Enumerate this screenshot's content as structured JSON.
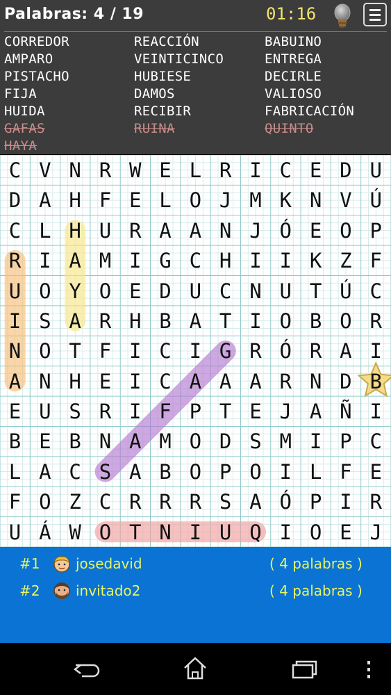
{
  "header": {
    "title": "Palabras: 4 / 19",
    "timer": "01:16",
    "hint_icon": "lightbulb-icon",
    "menu_icon": "hamburger-menu-icon"
  },
  "words": [
    {
      "text": "CORREDOR",
      "found": false
    },
    {
      "text": "REACCIÓN",
      "found": false
    },
    {
      "text": "BABUINO",
      "found": false
    },
    {
      "text": "AMPARO",
      "found": false
    },
    {
      "text": "VEINTICINCO",
      "found": false
    },
    {
      "text": "ENTREGA",
      "found": false
    },
    {
      "text": "PISTACHO",
      "found": false
    },
    {
      "text": "HUBIESE",
      "found": false
    },
    {
      "text": "DECIRLE",
      "found": false
    },
    {
      "text": "FIJA",
      "found": false
    },
    {
      "text": "DAMOS",
      "found": false
    },
    {
      "text": "VALIOSO",
      "found": false
    },
    {
      "text": "HUIDA",
      "found": false
    },
    {
      "text": "RECIBIR",
      "found": false
    },
    {
      "text": "FABRICACIÓN",
      "found": false
    },
    {
      "text": "GAFAS",
      "found": true
    },
    {
      "text": "RUINA",
      "found": true
    },
    {
      "text": "QUINTO",
      "found": true
    },
    {
      "text": "HAYA",
      "found": true
    }
  ],
  "grid": [
    [
      "C",
      "V",
      "N",
      "R",
      "W",
      "E",
      "L",
      "R",
      "I",
      "C",
      "E",
      "D",
      "U"
    ],
    [
      "D",
      "A",
      "H",
      "F",
      "E",
      "L",
      "O",
      "J",
      "M",
      "K",
      "N",
      "V",
      "Ú"
    ],
    [
      "C",
      "L",
      "H",
      "U",
      "R",
      "A",
      "A",
      "N",
      "J",
      "Ó",
      "E",
      "O",
      "P"
    ],
    [
      "R",
      "I",
      "A",
      "M",
      "I",
      "G",
      "C",
      "H",
      "I",
      "I",
      "K",
      "Z",
      "F"
    ],
    [
      "U",
      "O",
      "Y",
      "O",
      "E",
      "D",
      "U",
      "C",
      "N",
      "U",
      "T",
      "Ú",
      "C"
    ],
    [
      "I",
      "S",
      "A",
      "R",
      "H",
      "B",
      "A",
      "T",
      "I",
      "O",
      "B",
      "O",
      "R"
    ],
    [
      "N",
      "O",
      "T",
      "F",
      "I",
      "C",
      "I",
      "G",
      "R",
      "Ó",
      "R",
      "A",
      "I"
    ],
    [
      "A",
      "N",
      "H",
      "E",
      "I",
      "C",
      "A",
      "A",
      "A",
      "R",
      "N",
      "D",
      "B"
    ],
    [
      "E",
      "U",
      "S",
      "R",
      "I",
      "F",
      "P",
      "T",
      "E",
      "J",
      "A",
      "Ñ",
      "I"
    ],
    [
      "B",
      "E",
      "B",
      "N",
      "A",
      "M",
      "O",
      "D",
      "S",
      "M",
      "I",
      "P",
      "C"
    ],
    [
      "L",
      "A",
      "C",
      "S",
      "A",
      "B",
      "O",
      "P",
      "O",
      "I",
      "L",
      "F",
      "E"
    ],
    [
      "F",
      "O",
      "Z",
      "C",
      "R",
      "R",
      "R",
      "S",
      "A",
      "Ó",
      "P",
      "I",
      "R"
    ],
    [
      "U",
      "Á",
      "W",
      "O",
      "T",
      "N",
      "I",
      "U",
      "Q",
      "I",
      "O",
      "E",
      "J"
    ]
  ],
  "highlights": [
    {
      "word": "RUINA",
      "from": [
        3,
        0
      ],
      "to": [
        7,
        0
      ],
      "color": "#f6c07a"
    },
    {
      "word": "HAYA",
      "from": [
        2,
        2
      ],
      "to": [
        5,
        2
      ],
      "color": "#f8e88a"
    },
    {
      "word": "GAFAS",
      "from": [
        6,
        7
      ],
      "to": [
        10,
        3
      ],
      "color": "#b57ad0"
    },
    {
      "word": "QUINTO",
      "from": [
        12,
        3
      ],
      "to": [
        12,
        8
      ],
      "color": "#f2a0a0"
    }
  ],
  "star_cell": [
    7,
    12
  ],
  "players": [
    {
      "rank": "#1",
      "name": "josedavid",
      "score": "( 4 palabras )",
      "avatar": "blond-avatar-icon"
    },
    {
      "rank": "#2",
      "name": "invitado2",
      "score": "( 4 palabras )",
      "avatar": "bearded-avatar-icon"
    }
  ],
  "colors": {
    "header_bg": "#3c3c3c",
    "found_word": "#c98a8a",
    "timer": "#f2e36b",
    "scores_bg": "#0b73d4",
    "scores_text": "#e9f562"
  },
  "navbar": {
    "back_icon": "back-icon",
    "home_icon": "home-icon",
    "recents_icon": "recent-apps-icon",
    "more_icon": "more-vertical-icon"
  }
}
